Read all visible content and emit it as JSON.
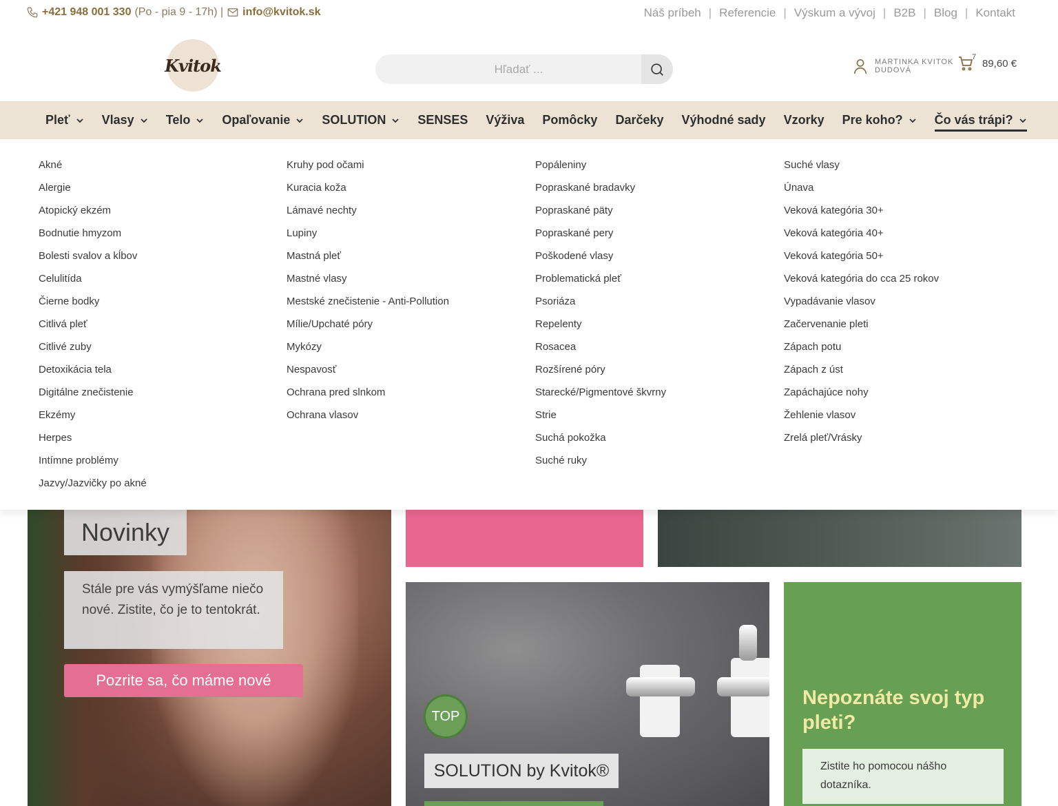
{
  "topbar": {
    "phone": "+421 948 001 330",
    "hours": "(Po - pia 9 - 17h) |",
    "email": "info@kvitok.sk",
    "links": [
      "Náš príbeh",
      "Referencie",
      "Výskum a vývoj",
      "B2B",
      "Blog",
      "Kontakt"
    ]
  },
  "header": {
    "logo_text": "Kvitok",
    "search_placeholder": "Hľadať ...",
    "user_name_line1": "MARTINKA KVITOK",
    "user_name_line2": "DUDOVÁ",
    "cart_count": "7",
    "cart_total": "89,60 €"
  },
  "nav": {
    "items": [
      {
        "label": "Pleť",
        "dropdown": true
      },
      {
        "label": "Vlasy",
        "dropdown": true
      },
      {
        "label": "Telo",
        "dropdown": true
      },
      {
        "label": "Opaľovanie",
        "dropdown": true
      },
      {
        "label": "SOLUTION",
        "dropdown": true
      },
      {
        "label": "SENSES",
        "dropdown": false
      },
      {
        "label": "Výživa",
        "dropdown": false
      },
      {
        "label": "Pomôcky",
        "dropdown": false
      },
      {
        "label": "Darčeky",
        "dropdown": false
      },
      {
        "label": "Výhodné sady",
        "dropdown": false
      },
      {
        "label": "Vzorky",
        "dropdown": false
      },
      {
        "label": "Pre koho?",
        "dropdown": true
      },
      {
        "label": "Čo vás trápi?",
        "dropdown": true,
        "active": true
      }
    ]
  },
  "mega_menu": {
    "columns": [
      [
        "Akné",
        "Alergie",
        "Atopický ekzém",
        "Bodnutie hmyzom",
        "Bolesti svalov a kĺbov",
        "Celulitída",
        "Čierne bodky",
        "Citlivá pleť",
        "Citlivé zuby",
        "Detoxikácia tela",
        "Digitálne znečistenie",
        "Ekzémy",
        "Herpes",
        "Intímne problémy",
        "Jazvy/Jazvičky po akné"
      ],
      [
        "Kruhy pod očami",
        "Kuracia koža",
        "Lámavé nechty",
        "Lupiny",
        "Mastná pleť",
        "Mastné vlasy",
        "Mestské znečistenie - Anti-Pollution",
        "Mílie/Upchaté póry",
        "Mykózy",
        "Nespavosť",
        "Ochrana pred slnkom",
        "Ochrana vlasov"
      ],
      [
        "Popáleniny",
        "Popraskané bradavky",
        "Popraskané päty",
        "Popraskané pery",
        "Poškodené vlasy",
        "Problematická pleť",
        "Psoriáza",
        "Repelenty",
        "Rosacea",
        "Rozšírené póry",
        "Starecké/Pigmentové škvrny",
        "Strie",
        "Suchá pokožka",
        "Suché ruky"
      ],
      [
        "Suché vlasy",
        "Únava",
        "Veková kategória 30+",
        "Veková kategória 40+",
        "Veková kategória 50+",
        "Veková kategória do cca 25 rokov",
        "Vypadávanie vlasov",
        "Začervenanie pleti",
        "Zápach potu",
        "Zápach z úst",
        "Zapáchajúce nohy",
        "Žehlenie vlasov",
        "Zrelá pleť/Vrásky"
      ]
    ]
  },
  "banners": {
    "novinky": {
      "title": "Novinky",
      "text": "Stále pre vás vymýšľame niečo nové. Zistite, čo je to tentokrát.",
      "button": "Pozrite sa, čo máme nové"
    },
    "solution": {
      "badge": "TOP",
      "label": "SOLUTION by Kvitok®"
    },
    "skin_type": {
      "title": "Nepoznáte svoj typ pleti?",
      "text": "Zistite ho pomocou nášho dotazníka."
    }
  },
  "colors": {
    "nav_bg": "#ede3d5",
    "brand_brown": "#8a6d3b",
    "pink": "#e46f93",
    "green": "#67a052"
  }
}
